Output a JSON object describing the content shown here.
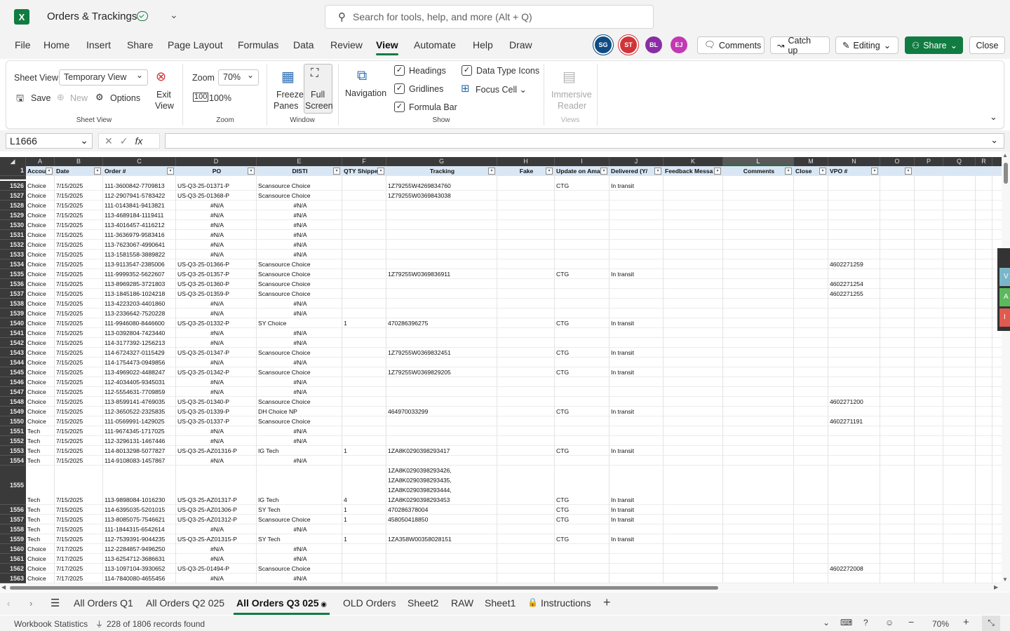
{
  "app": {
    "title": "Orders & Trackings",
    "search_placeholder": "Search for tools, help, and more (Alt + Q)"
  },
  "menu": [
    "File",
    "Home",
    "Insert",
    "Share",
    "Page Layout",
    "Formulas",
    "Data",
    "Review",
    "View",
    "Automate",
    "Help",
    "Draw"
  ],
  "active_menu": "View",
  "avatars": [
    {
      "initials": "SG",
      "color": "#0f4c81"
    },
    {
      "initials": "ST",
      "color": "#d13438"
    },
    {
      "initials": "BL",
      "color": "#8a2da5"
    },
    {
      "initials": "EJ",
      "color": "#c239b3"
    }
  ],
  "top_buttons": {
    "comments": "Comments",
    "catchup": "Catch up",
    "editing": "Editing",
    "share": "Share",
    "close": "Close"
  },
  "ribbon": {
    "sheet_view_label": "Sheet View",
    "sheet_view_value": "Temporary View",
    "save": "Save",
    "new": "New",
    "options": "Options",
    "exit_view_1": "Exit",
    "exit_view_2": "View",
    "group_sheet_view": "Sheet View",
    "zoom_label": "Zoom",
    "zoom_value": "70%",
    "zoom_100": "100%",
    "group_zoom": "Zoom",
    "freeze_1": "Freeze",
    "freeze_2": "Panes",
    "full_1": "Full",
    "full_2": "Screen",
    "group_window": "Window",
    "navigation": "Navigation",
    "headings": "Headings",
    "gridlines": "Gridlines",
    "formula_bar": "Formula Bar",
    "data_type_icons": "Data Type Icons",
    "focus_cell": "Focus Cell",
    "group_show": "Show",
    "immersive_1": "Immersive",
    "immersive_2": "Reader",
    "group_views": "Views"
  },
  "formula": {
    "name_box": "L1666",
    "fx": "fx",
    "value": ""
  },
  "columns": [
    {
      "letter": "A",
      "header": "Accou"
    },
    {
      "letter": "B",
      "header": "Date"
    },
    {
      "letter": "C",
      "header": "Order #"
    },
    {
      "letter": "D",
      "header": "PO"
    },
    {
      "letter": "E",
      "header": "DISTI"
    },
    {
      "letter": "F",
      "header": "QTY Shipped"
    },
    {
      "letter": "G",
      "header": "Tracking"
    },
    {
      "letter": "H",
      "header": "Fake"
    },
    {
      "letter": "I",
      "header": "Update on Amaz"
    },
    {
      "letter": "J",
      "header": "Delivered (Y/"
    },
    {
      "letter": "K",
      "header": "Feedback Messa"
    },
    {
      "letter": "L",
      "header": "Comments"
    },
    {
      "letter": "M",
      "header": "Close"
    },
    {
      "letter": "N",
      "header": "VPO #"
    },
    {
      "letter": "O",
      "header": ""
    },
    {
      "letter": "P",
      "header": ""
    },
    {
      "letter": "Q",
      "header": ""
    },
    {
      "letter": "R",
      "header": ""
    }
  ],
  "selected_column": "L",
  "header_row_number": "1",
  "rows": [
    {
      "n": "1526",
      "a": "Choice",
      "b": "7/15/2025",
      "c": "111-3600842-7709813",
      "d": "US-Q3-25-01371-P",
      "e": "Scansource Choice",
      "f": "",
      "g": "1Z79255W4269834760",
      "i": "CTG",
      "j": "In transit",
      "n2": ""
    },
    {
      "n": "1527",
      "a": "Choice",
      "b": "7/15/2025",
      "c": "112-2907941-5783422",
      "d": "US-Q3-25-01368-P",
      "e": "Scansource Choice",
      "f": "",
      "g": "1Z79255W0369843038",
      "i": "",
      "j": "",
      "n2": ""
    },
    {
      "n": "1528",
      "a": "Choice",
      "b": "7/15/2025",
      "c": "111-0143841-9413821",
      "d": "#N/A",
      "e": "#N/A",
      "f": "",
      "g": "",
      "i": "",
      "j": "",
      "n2": ""
    },
    {
      "n": "1529",
      "a": "Choice",
      "b": "7/15/2025",
      "c": "113-4689184-1119411",
      "d": "#N/A",
      "e": "#N/A",
      "f": "",
      "g": "",
      "i": "",
      "j": "",
      "n2": ""
    },
    {
      "n": "1530",
      "a": "Choice",
      "b": "7/15/2025",
      "c": "113-4016457-4116212",
      "d": "#N/A",
      "e": "#N/A",
      "f": "",
      "g": "",
      "i": "",
      "j": "",
      "n2": ""
    },
    {
      "n": "1531",
      "a": "Choice",
      "b": "7/15/2025",
      "c": "111-3636979-9583416",
      "d": "#N/A",
      "e": "#N/A",
      "f": "",
      "g": "",
      "i": "",
      "j": "",
      "n2": ""
    },
    {
      "n": "1532",
      "a": "Choice",
      "b": "7/15/2025",
      "c": "113-7623067-4990641",
      "d": "#N/A",
      "e": "#N/A",
      "f": "",
      "g": "",
      "i": "",
      "j": "",
      "n2": ""
    },
    {
      "n": "1533",
      "a": "Choice",
      "b": "7/15/2025",
      "c": "113-1581558-3889822",
      "d": "#N/A",
      "e": "#N/A",
      "f": "",
      "g": "",
      "i": "",
      "j": "",
      "n2": ""
    },
    {
      "n": "1534",
      "a": "Choice",
      "b": "7/15/2025",
      "c": "113-9113547-2385006",
      "d": "US-Q3-25-01366-P",
      "e": "Scansource Choice",
      "f": "",
      "g": "",
      "i": "",
      "j": "",
      "n2": "4602271259"
    },
    {
      "n": "1535",
      "a": "Choice",
      "b": "7/15/2025",
      "c": "111-9999352-5622607",
      "d": "US-Q3-25-01357-P",
      "e": "Scansource Choice",
      "f": "",
      "g": "1Z79255W0369836911",
      "i": "CTG",
      "j": "In transit",
      "n2": ""
    },
    {
      "n": "1536",
      "a": "Choice",
      "b": "7/15/2025",
      "c": "113-8969285-3721803",
      "d": "US-Q3-25-01360-P",
      "e": "Scansource Choice",
      "f": "",
      "g": "",
      "i": "",
      "j": "",
      "n2": "4602271254"
    },
    {
      "n": "1537",
      "a": "Choice",
      "b": "7/15/2025",
      "c": "113-1845186-1024218",
      "d": "US-Q3-25-01359-P",
      "e": "Scansource Choice",
      "f": "",
      "g": "",
      "i": "",
      "j": "",
      "n2": "4602271255"
    },
    {
      "n": "1538",
      "a": "Choice",
      "b": "7/15/2025",
      "c": "113-4223203-4401860",
      "d": "#N/A",
      "e": "#N/A",
      "f": "",
      "g": "",
      "i": "",
      "j": "",
      "n2": ""
    },
    {
      "n": "1539",
      "a": "Choice",
      "b": "7/15/2025",
      "c": "113-2336642-7520228",
      "d": "#N/A",
      "e": "#N/A",
      "f": "",
      "g": "",
      "i": "",
      "j": "",
      "n2": ""
    },
    {
      "n": "1540",
      "a": "Choice",
      "b": "7/15/2025",
      "c": "111-9946080-8446600",
      "d": "US-Q3-25-01332-P",
      "e": "SY Choice",
      "f": "1",
      "g": "470286396275",
      "i": "CTG",
      "j": "In transit",
      "n2": ""
    },
    {
      "n": "1541",
      "a": "Choice",
      "b": "7/15/2025",
      "c": "113-0392804-7423440",
      "d": "#N/A",
      "e": "#N/A",
      "f": "",
      "g": "",
      "i": "",
      "j": "",
      "n2": ""
    },
    {
      "n": "1542",
      "a": "Choice",
      "b": "7/15/2025",
      "c": "114-3177392-1256213",
      "d": "#N/A",
      "e": "#N/A",
      "f": "",
      "g": "",
      "i": "",
      "j": "",
      "n2": ""
    },
    {
      "n": "1543",
      "a": "Choice",
      "b": "7/15/2025",
      "c": "114-6724327-0115429",
      "d": "US-Q3-25-01347-P",
      "e": "Scansource Choice",
      "f": "",
      "g": "1Z79255W0369832451",
      "i": "CTG",
      "j": "In transit",
      "n2": ""
    },
    {
      "n": "1544",
      "a": "Choice",
      "b": "7/15/2025",
      "c": "114-1754473-0949856",
      "d": "#N/A",
      "e": "#N/A",
      "f": "",
      "g": "",
      "i": "",
      "j": "",
      "n2": ""
    },
    {
      "n": "1545",
      "a": "Choice",
      "b": "7/15/2025",
      "c": "113-4969022-4488247",
      "d": "US-Q3-25-01342-P",
      "e": "Scansource Choice",
      "f": "",
      "g": "1Z79255W0369829205",
      "i": "CTG",
      "j": "In transit",
      "n2": ""
    },
    {
      "n": "1546",
      "a": "Choice",
      "b": "7/15/2025",
      "c": "112-4034405-9345031",
      "d": "#N/A",
      "e": "#N/A",
      "f": "",
      "g": "",
      "i": "",
      "j": "",
      "n2": ""
    },
    {
      "n": "1547",
      "a": "Choice",
      "b": "7/15/2025",
      "c": "112-5554631-7709859",
      "d": "#N/A",
      "e": "#N/A",
      "f": "",
      "g": "",
      "i": "",
      "j": "",
      "n2": ""
    },
    {
      "n": "1548",
      "a": "Choice",
      "b": "7/15/2025",
      "c": "113-8599141-4769035",
      "d": "US-Q3-25-01340-P",
      "e": "Scansource Choice",
      "f": "",
      "g": "",
      "i": "",
      "j": "",
      "n2": "4602271200"
    },
    {
      "n": "1549",
      "a": "Choice",
      "b": "7/15/2025",
      "c": "112-3650522-2325835",
      "d": "US-Q3-25-01339-P",
      "e": "DH Choice NP",
      "f": "",
      "g": "464970033299",
      "i": "CTG",
      "j": "In transit",
      "n2": ""
    },
    {
      "n": "1550",
      "a": "Choice",
      "b": "7/15/2025",
      "c": "111-0569991-1429025",
      "d": "US-Q3-25-01337-P",
      "e": "Scansource Choice",
      "f": "",
      "g": "",
      "i": "",
      "j": "",
      "n2": "4602271191"
    },
    {
      "n": "1551",
      "a": "Tech",
      "b": "7/15/2025",
      "c": "111-9674345-1717025",
      "d": "#N/A",
      "e": "#N/A",
      "f": "",
      "g": "",
      "i": "",
      "j": "",
      "n2": ""
    },
    {
      "n": "1552",
      "a": "Tech",
      "b": "7/15/2025",
      "c": "112-3296131-1467446",
      "d": "#N/A",
      "e": "#N/A",
      "f": "",
      "g": "",
      "i": "",
      "j": "",
      "n2": ""
    },
    {
      "n": "1553",
      "a": "Tech",
      "b": "7/15/2025",
      "c": "114-8013298-5077827",
      "d": "US-Q3-25-AZ01316-P",
      "e": "IG Tech",
      "f": "1",
      "g": "1ZA8K0290398293417",
      "i": "CTG",
      "j": "In transit",
      "n2": ""
    },
    {
      "n": "1554",
      "a": "Tech",
      "b": "7/15/2025",
      "c": "114-9108083-1457867",
      "d": "#N/A",
      "e": "#N/A",
      "f": "",
      "g": "",
      "i": "",
      "j": "",
      "n2": ""
    },
    {
      "n": "1555",
      "tall": true,
      "a": "Tech",
      "b": "7/15/2025",
      "c": "113-9898084-1016230",
      "d": "US-Q3-25-AZ01317-P",
      "e": "IG Tech",
      "f": "4",
      "g": "1ZA8K0290398293426,",
      "g2": "1ZA8K0290398293435,",
      "g3": "1ZA8K0290398293444,",
      "g4": "1ZA8K0290398293453",
      "i": "CTG",
      "j": "In transit",
      "n2": ""
    },
    {
      "n": "1556",
      "a": "Tech",
      "b": "7/15/2025",
      "c": "114-6395035-5201015",
      "d": "US-Q3-25-AZ01306-P",
      "e": "SY Tech",
      "f": "1",
      "g": "470286378004",
      "i": "CTG",
      "j": "In transit",
      "n2": ""
    },
    {
      "n": "1557",
      "a": "Tech",
      "b": "7/15/2025",
      "c": "113-8085075-7546621",
      "d": "US-Q3-25-AZ01312-P",
      "e": "Scansource Choice",
      "f": "1",
      "g": "458050418850",
      "i": "CTG",
      "j": "In transit",
      "n2": ""
    },
    {
      "n": "1558",
      "a": "Tech",
      "b": "7/15/2025",
      "c": "111-1844315-6542614",
      "d": "#N/A",
      "e": "#N/A",
      "f": "",
      "g": "",
      "i": "",
      "j": "",
      "n2": ""
    },
    {
      "n": "1559",
      "a": "Tech",
      "b": "7/15/2025",
      "c": "112-7539391-9044235",
      "d": "US-Q3-25-AZ01315-P",
      "e": "SY Tech",
      "f": "1",
      "g": "1ZA358W00358028151",
      "i": "CTG",
      "j": "In transit",
      "n2": ""
    },
    {
      "n": "1560",
      "a": "Choice",
      "b": "7/17/2025",
      "c": "112-2284857-9496250",
      "d": "#N/A",
      "e": "#N/A",
      "f": "",
      "g": "",
      "i": "",
      "j": "",
      "n2": ""
    },
    {
      "n": "1561",
      "a": "Choice",
      "b": "7/17/2025",
      "c": "113-6254712-3686631",
      "d": "#N/A",
      "e": "#N/A",
      "f": "",
      "g": "",
      "i": "",
      "j": "",
      "n2": ""
    },
    {
      "n": "1562",
      "a": "Choice",
      "b": "7/17/2025",
      "c": "113-1097104-3930652",
      "d": "US-Q3-25-01494-P",
      "e": "Scansource Choice",
      "f": "",
      "g": "",
      "i": "",
      "j": "",
      "n2": "4602272008"
    },
    {
      "n": "1563",
      "a": "Choice",
      "b": "7/17/2025",
      "c": "114-7840080-4655456",
      "d": "#N/A",
      "e": "#N/A",
      "f": "",
      "g": "",
      "i": "",
      "j": "",
      "n2": ""
    }
  ],
  "side_panel_letters": [
    "V",
    "A",
    "I"
  ],
  "side_panel_colors": [
    "#7ab6c9",
    "#5cb85c",
    "#e05a4f"
  ],
  "sheets": [
    {
      "name": "All Orders Q1"
    },
    {
      "name": "All Orders Q2 025"
    },
    {
      "name": "All Orders Q3 025",
      "active": true
    },
    {
      "name": "OLD Orders"
    },
    {
      "name": "Sheet2"
    },
    {
      "name": "RAW"
    },
    {
      "name": "Sheet1"
    },
    {
      "name": "Instructions",
      "locked": true
    }
  ],
  "status": {
    "workbook_stats": "Workbook Statistics",
    "records": "228 of 1806 records found",
    "zoom": "70%"
  },
  "colors": {
    "accent": "#107c41",
    "header_fill": "#d9e7f5",
    "col_header_bg": "#3a3a3a"
  }
}
